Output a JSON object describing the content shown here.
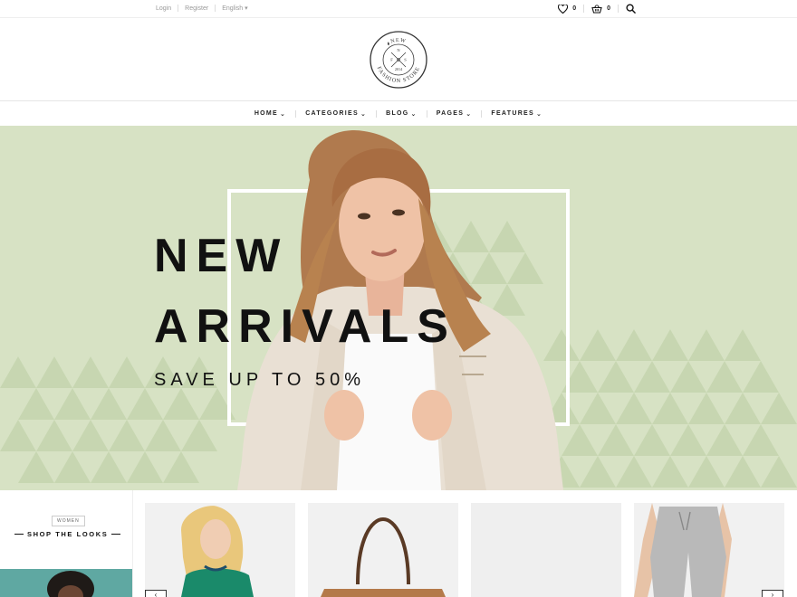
{
  "topbar": {
    "login": "Login",
    "register": "Register",
    "language": "English",
    "wishlist_count": "0",
    "cart_count": "0"
  },
  "logo": {
    "top_text": "NEW",
    "bottom_text": "FASHION STORE",
    "letters": [
      "N",
      "F",
      "S"
    ],
    "year": "2014"
  },
  "nav": {
    "items": [
      {
        "label": "HOME"
      },
      {
        "label": "CATEGORIES"
      },
      {
        "label": "BLOG"
      },
      {
        "label": "PAGES"
      },
      {
        "label": "FEATURES"
      }
    ]
  },
  "hero": {
    "line1": "NEW",
    "line2": "ARRIVALS",
    "subtitle": "SAVE UP TO 50%",
    "bg_color": "#d7e2c4"
  },
  "shop_looks": {
    "badge": "WOMEN",
    "title": "SHOP THE LOOKS"
  },
  "colors": {
    "accent": "#111111",
    "teal": "#5fa8a2"
  }
}
